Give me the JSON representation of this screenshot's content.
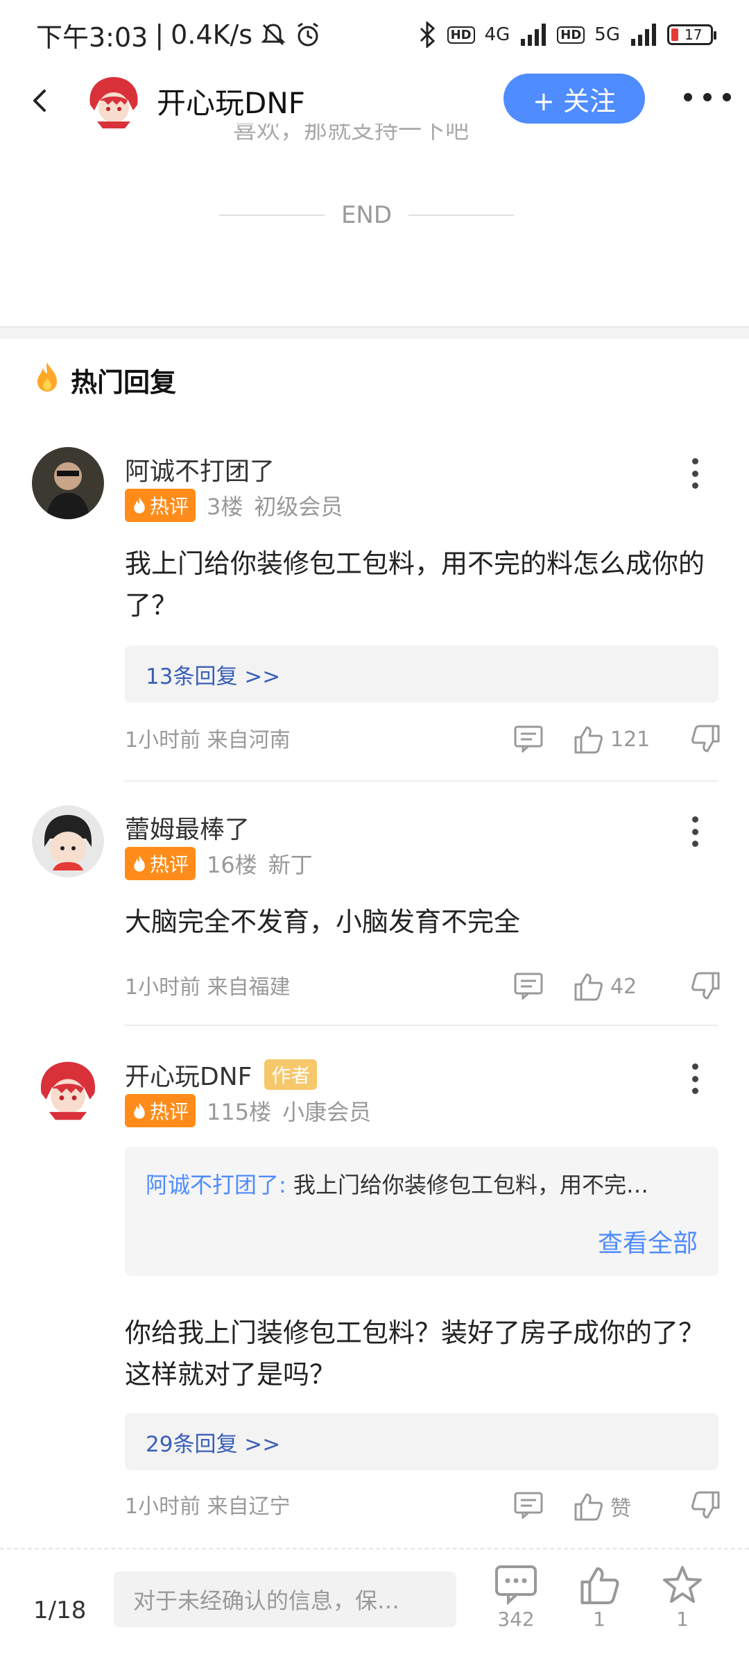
{
  "status": {
    "time": "下午3:03",
    "speed": "0.4K/s",
    "net1": "4G",
    "net2": "5G",
    "hd": "HD",
    "battery": "17"
  },
  "header": {
    "title": "开心玩DNF",
    "follow_label": "+ 关注",
    "follow_color": "#4e8cff"
  },
  "article": {
    "cut_text": "喜欢，那就支持一下吧",
    "end": "END"
  },
  "hot": {
    "title": "热门回复"
  },
  "comments": [
    {
      "name": "阿诚不打团了",
      "badge": "热评",
      "floor": "3楼",
      "level": "初级会员",
      "text": "我上门给你装修包工包料，用不完的料怎么成你的了？",
      "replies": "13条回复 >>",
      "time": "1小时前 来自河南",
      "likes": "121"
    },
    {
      "name": "蕾姆最棒了",
      "badge": "热评",
      "floor": "16楼",
      "level": "新丁",
      "text": "大脑完全不发育，小脑发育不完全",
      "time": "1小时前 来自福建",
      "likes": "42"
    },
    {
      "name": "开心玩DNF",
      "author": "作者",
      "badge": "热评",
      "floor": "115楼",
      "level": "小康会员",
      "quote_user": "阿诚不打团了:",
      "quote_text": "我上门给你装修包工包料，用不完…",
      "quote_all": "查看全部",
      "text": "你给我上门装修包工包料？装好了房子成你的了？这样就对了是吗？",
      "replies": "29条回复 >>",
      "time": "1小时前 来自辽宁",
      "likes": "赞"
    }
  ],
  "bottom": {
    "page": "1/18",
    "placeholder": "对于未经确认的信息，保…",
    "comments_count": "342",
    "likes_count": "1",
    "stars_count": "1"
  },
  "colors": {
    "accent": "#4e8cff",
    "hot_badge": "#ff8c1a",
    "author_badge": "#f7c76b",
    "reply_link": "#3a5fb8"
  }
}
